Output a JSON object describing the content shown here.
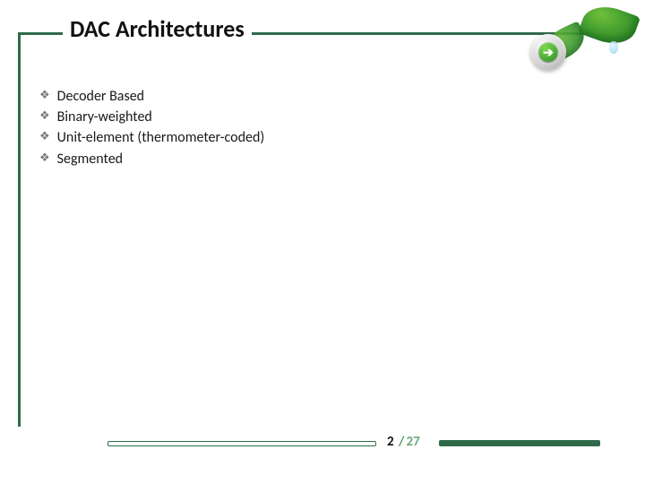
{
  "title": "DAC Architectures",
  "bullets": [
    "Decoder Based",
    "Binary-weighted",
    "Unit-element (thermometer-coded)",
    "Segmented"
  ],
  "nav": {
    "icon_glyph": "➔"
  },
  "pager": {
    "current": "2",
    "separator": "/",
    "total": "27"
  }
}
